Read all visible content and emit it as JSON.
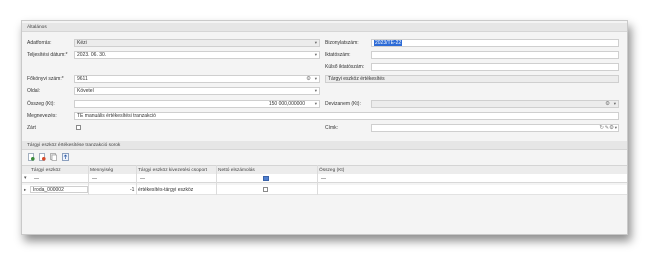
{
  "section_general": {
    "title": "Általános"
  },
  "form": {
    "adatforras_label": "Adatforrás:",
    "adatforras_value": "Kézi",
    "teljesitesi_datum_label": "Teljesítési dátum:*",
    "teljesitesi_datum_value": "2023. 06. 30.",
    "fokonyvi_szam_label": "Főkönyvi szám:*",
    "fokonyvi_szam_value": "9611",
    "oldal_label": "Oldal:",
    "oldal_value": "Követel",
    "osszeg_label": "Összeg (Kt):",
    "osszeg_value": "150 000,000000",
    "megnevezes_label": "Megnevezés:",
    "megnevezes_value": "TE manuális értékesítési tranzakció",
    "zart_label": "Zárt",
    "bizonylatszam_label": "Bizonylatszám:",
    "bizonylatszam_value": "2023/TÉ-22",
    "iktatoszam_label": "Iktatószám:",
    "iktatoszam_value": "",
    "kulso_iktatoszam_label": "Külső iktatószám:",
    "kulso_iktatoszam_value": "",
    "tipus_value": "Tárgyi eszköz értékesítés",
    "devizanem_label": "Devizanem (Kt):",
    "devizanem_value": "",
    "cimke_label": "Címk:",
    "cimke_value": ""
  },
  "section_grid": {
    "title": "Tárgyi eszköz értékesítése tranzakció sorok"
  },
  "grid": {
    "columns": [
      "Tárgyi eszköz",
      "Mennyiség",
      "Tárgyi eszköz kivezetési csoport",
      "Nettó elszámolás",
      "Összeg (Kt)"
    ],
    "filter_placeholder": "—",
    "rows": [
      {
        "asset": "Iroda_000002",
        "quantity": "-1",
        "group": "értékesítés-tárgyi eszköz",
        "net": false,
        "amount": ""
      }
    ]
  },
  "icons": [
    "add-row-icon",
    "delete-row-icon",
    "copy-row-icon",
    "export-icon",
    "gear-icon",
    "dropdown-icon",
    "refresh-icon",
    "edit-icon"
  ],
  "colors": {
    "selection": "#2d6bd6",
    "header_bg": "#e6e6e6",
    "window_bg": "#f4f4f4"
  }
}
